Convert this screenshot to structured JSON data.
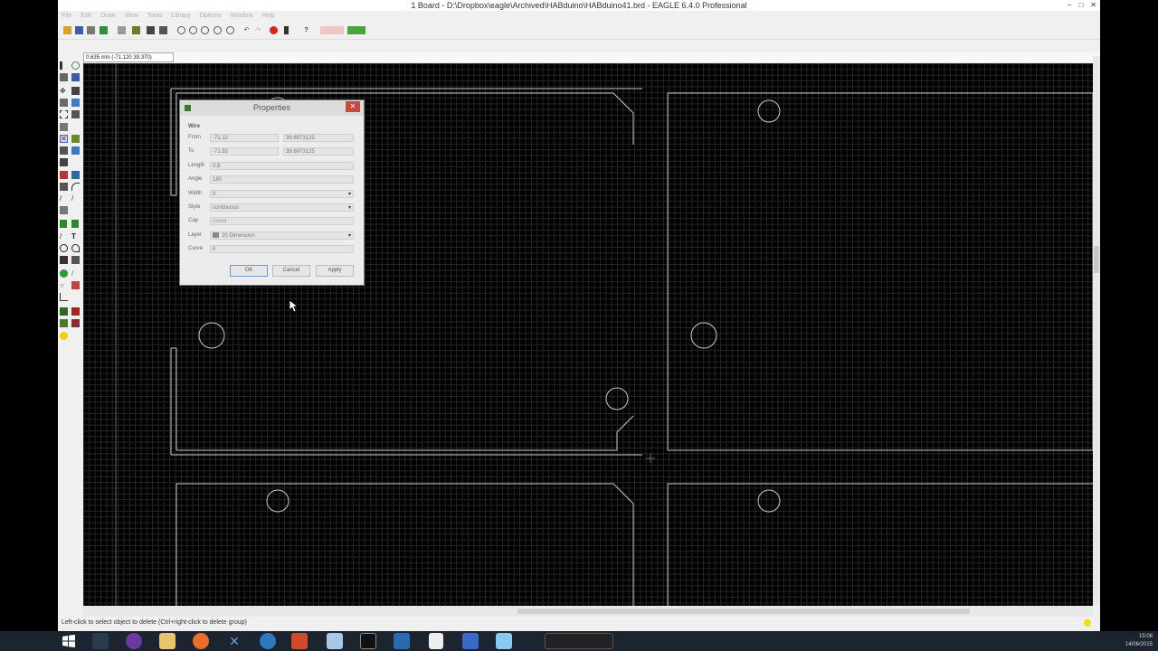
{
  "window": {
    "title": "1 Board - D:\\Dropbox\\eagle\\Archived\\HABduino\\HABduino41.brd - EAGLE 6.4.0 Professional",
    "minimize": "–",
    "maximize": "□",
    "close": "✕"
  },
  "menu": [
    "File",
    "Edit",
    "Draw",
    "View",
    "Tools",
    "Library",
    "Options",
    "Window",
    "Help"
  ],
  "coord_display": "0.635 mm (-71.120 39.370)",
  "status_message": "Left-click to select object to delete (Ctrl+right-click to delete group)",
  "dialog": {
    "title": "Properties",
    "group": "Wire",
    "fields": {
      "from_label": "From",
      "from_x": "-71.12",
      "from_y": "39.6973125",
      "to_label": "To",
      "to_x": "-71.92",
      "to_y": "39.6973125",
      "length_label": "Length",
      "length": "0.8",
      "angle_label": "Angle",
      "angle": "180",
      "width_label": "Width",
      "width": "0",
      "style_label": "Style",
      "style": "continuous",
      "cap_label": "Cap",
      "cap": "round",
      "layer_label": "Layer",
      "layer": "20 Dimension",
      "curve_label": "Curve",
      "curve": "0"
    },
    "buttons": {
      "ok": "OK",
      "cancel": "Cancel",
      "apply": "Apply"
    }
  },
  "colors": {
    "canvas": "#000000",
    "board_outline": "#c8c8c8",
    "grid": "#262626"
  },
  "taskbar": {
    "time": "15:08",
    "date": "14/06/2015",
    "icons": [
      "windows-start-icon",
      "steam-icon",
      "app-icon",
      "file-explorer-icon",
      "firefox-icon",
      "xilinx-icon",
      "wifi-app-icon",
      "acrobat-icon",
      "notepad-icon",
      "terminal-icon",
      "inkscape-icon",
      "cursor-icon",
      "vs-icon",
      "paint-icon",
      "recorder-icon"
    ]
  }
}
